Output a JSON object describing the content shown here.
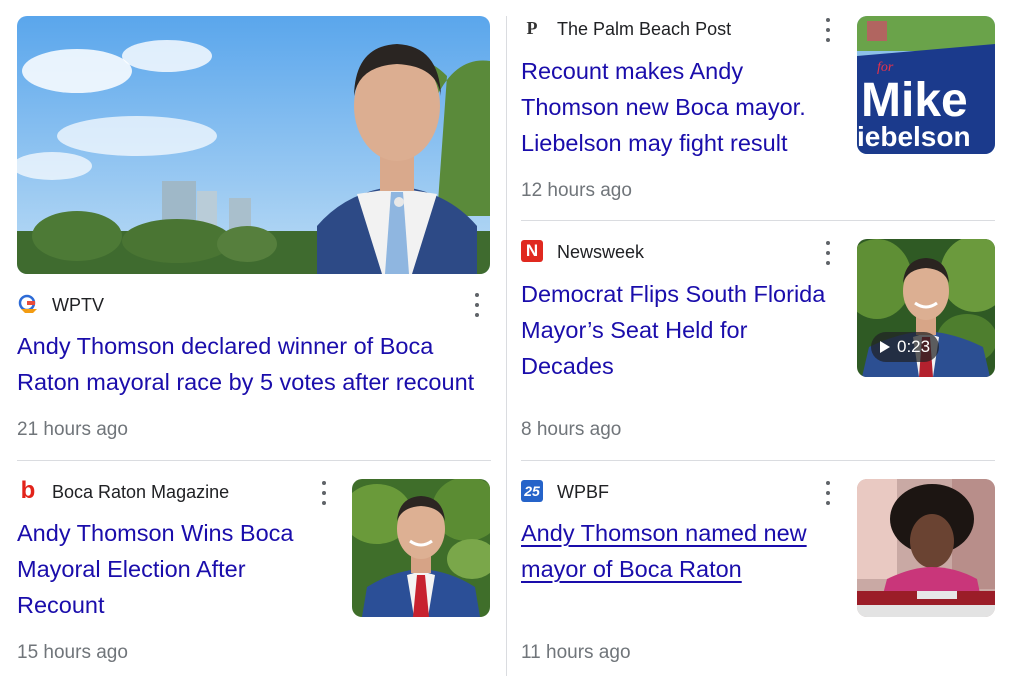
{
  "articles": [
    {
      "source": "WPTV",
      "logo_icon": "wptv-logo-icon",
      "headline": "Andy Thomson declared winner of Boca Raton mayoral race by 5 votes after recount",
      "time": "21 hours ago"
    },
    {
      "source": "The Palm Beach Post",
      "logo_icon": "palm-beach-post-logo-icon",
      "logo_text": "P",
      "headline": "Recount makes Andy Thomson new Boca mayor. Liebelson may fight result",
      "time": "12 hours ago",
      "thumbnail_sign_text": [
        "Mike",
        "iebelson"
      ]
    },
    {
      "source": "Newsweek",
      "logo_icon": "newsweek-logo-icon",
      "logo_text": "N",
      "headline": "Democrat Flips South Florida Mayor’s Seat Held for Decades",
      "time": "8 hours ago",
      "video_duration": "0:23"
    },
    {
      "source": "Boca Raton Magazine",
      "logo_icon": "boca-raton-magazine-logo-icon",
      "logo_text": "b",
      "headline": "Andy Thomson Wins Boca Mayoral Election After Recount",
      "time": "15 hours ago"
    },
    {
      "source": "WPBF",
      "logo_icon": "wpbf-logo-icon",
      "logo_text": "25",
      "headline": "Andy Thomson named new mayor of Boca Raton",
      "time": "11 hours ago"
    }
  ],
  "colors": {
    "headline": "#1a0dab",
    "time": "#70757a",
    "source": "#202124",
    "divider": "#dadce0",
    "newsweek_red": "#e0291f",
    "boca_red": "#e2231a",
    "wpbf_blue": "#2563c9"
  }
}
